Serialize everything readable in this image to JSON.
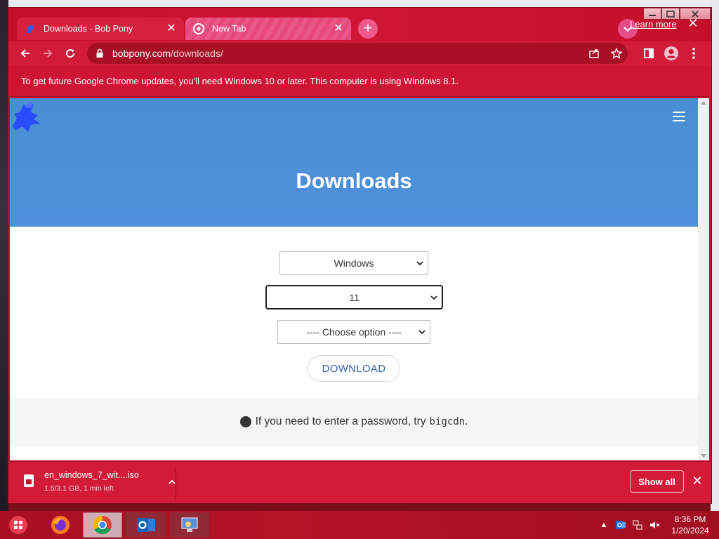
{
  "browser": {
    "tabs": [
      {
        "title": "Downloads - Bob Pony",
        "icon": "pony-favicon",
        "active": true
      },
      {
        "title": "New Tab",
        "icon": "chrome-icon",
        "active": false
      }
    ],
    "url_host": "bobpony.com",
    "url_path": "/downloads/",
    "theme_color": "#c8102e"
  },
  "infobar": {
    "message": "To get future Google Chrome updates, you'll need Windows 10 or later. This computer is using Windows 8.1.",
    "link_label": "Learn more"
  },
  "page": {
    "title": "Downloads",
    "hero_color": "#4a8fd3",
    "selects": {
      "os": "Windows",
      "version": "11",
      "option": "---- Choose option ----"
    },
    "download_label": "DOWNLOAD",
    "hint_text": "If you need to enter a password, try",
    "hint_code": "bigcdn",
    "hint_end": "."
  },
  "download_shelf": {
    "file_name": "en_windows_7_wit....iso",
    "status": "1.5/3.1 GB, 1 min left",
    "show_all_label": "Show all"
  },
  "taskbar": {
    "apps": [
      "start-orb",
      "firefox",
      "chrome",
      "outlook",
      "remote-desktop"
    ],
    "time": "8:36 PM",
    "date": "1/20/2024"
  }
}
